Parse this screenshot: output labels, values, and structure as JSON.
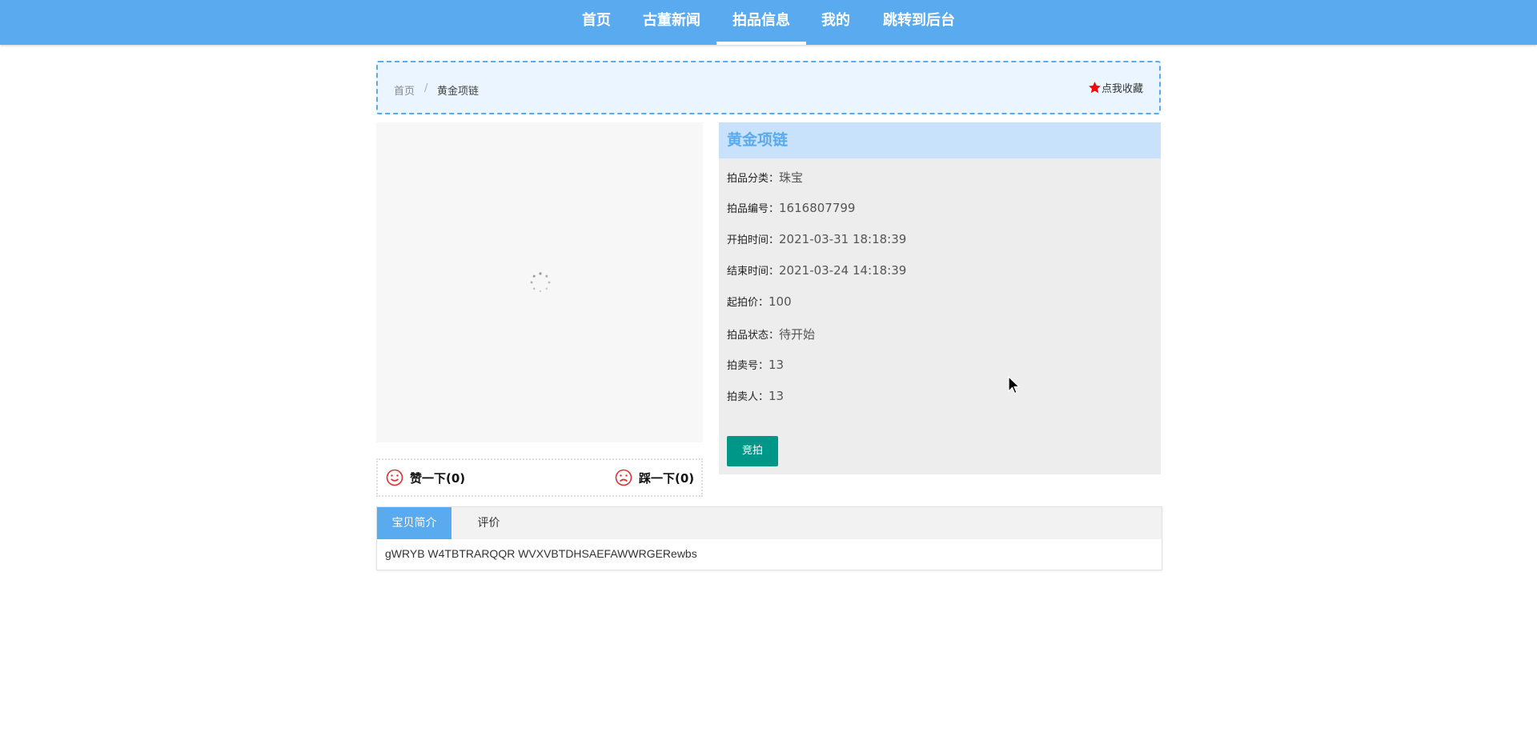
{
  "nav": {
    "items": [
      {
        "label": "首页"
      },
      {
        "label": "古董新闻"
      },
      {
        "label": "拍品信息"
      },
      {
        "label": "我的"
      },
      {
        "label": "跳转到后台"
      }
    ],
    "active": "拍品信息"
  },
  "breadcrumb": {
    "home": "首页",
    "separator": "/",
    "current": "黄金项链"
  },
  "favorite": {
    "label": "点我收藏",
    "icon": "star-icon",
    "color": "#ff0000"
  },
  "like_bar": {
    "like_label": "赞一下(0)",
    "like_icon": "smile-icon",
    "dislike_label": "踩一下(0)",
    "dislike_icon": "frown-icon",
    "icon_color": "#e03030"
  },
  "item": {
    "title": "黄金项链",
    "fields": [
      {
        "label": "拍品分类：",
        "value": "珠宝"
      },
      {
        "label": "拍品编号：",
        "value": "1616807799"
      },
      {
        "label": "开拍时间：",
        "value": "2021-03-31 18:18:39"
      },
      {
        "label": "结束时间：",
        "value": "2021-03-24 14:18:39"
      },
      {
        "label": "起拍价：",
        "value": "100"
      },
      {
        "label": "拍品状态：",
        "value": "待开始"
      },
      {
        "label": "拍卖号：",
        "value": "13"
      },
      {
        "label": "拍卖人：",
        "value": "13"
      }
    ],
    "bid_button": "竞拍"
  },
  "tabs": {
    "items": [
      {
        "label": "宝贝简介"
      },
      {
        "label": "评价"
      }
    ],
    "active": "宝贝简介",
    "content": "gWRYB W4TBTRARQQR WVXVBTDHSAEFAWWRGERewbs"
  },
  "colors": {
    "nav": "#5aaaf0",
    "accent": "#5aaaf0",
    "bid_button": "#009688"
  }
}
